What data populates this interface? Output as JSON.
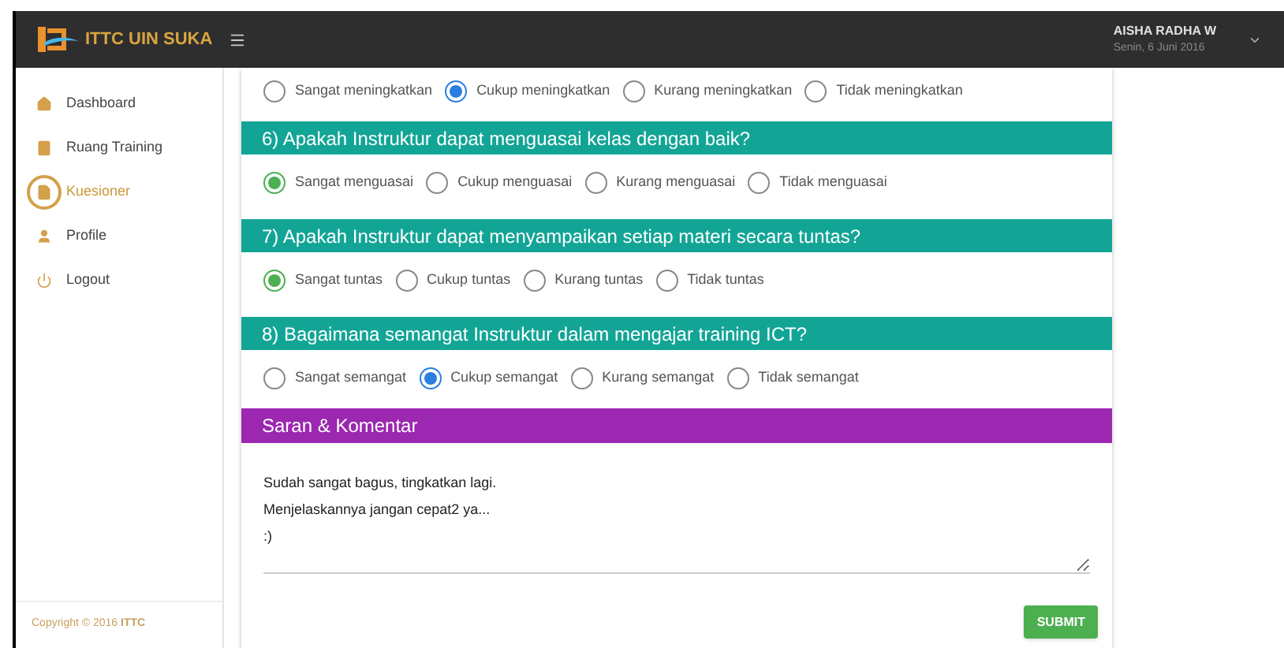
{
  "header": {
    "brand": "ITTC UIN SUKA",
    "user_name": "AISHA RADHA W",
    "date": "Senin, 6 Juni 2016"
  },
  "sidebar": {
    "items": [
      {
        "label": "Dashboard",
        "selected": false
      },
      {
        "label": "Ruang Training",
        "selected": false
      },
      {
        "label": "Kuesioner",
        "selected": true
      },
      {
        "label": "Profile",
        "selected": false
      },
      {
        "label": "Logout",
        "selected": false
      }
    ],
    "copyright": "Copyright © 2016 **ITTC**"
  },
  "questions": [
    {
      "options": [
        {
          "label": "Sangat meningkatkan",
          "selected": false
        },
        {
          "label": "Cukup meningkatkan",
          "selected": true
        },
        {
          "label": "Kurang meningkatkan",
          "selected": false
        },
        {
          "label": "Tidak meningkatkan",
          "selected": false
        }
      ]
    },
    {
      "title": "6) Apakah Instruktur dapat menguasai kelas dengan baik?",
      "options": [
        {
          "label": "Sangat menguasai",
          "selected": true
        },
        {
          "label": "Cukup menguasai",
          "selected": false
        },
        {
          "label": "Kurang menguasai",
          "selected": false
        },
        {
          "label": "Tidak menguasai",
          "selected": false
        }
      ]
    },
    {
      "title": "7) Apakah Instruktur dapat menyampaikan setiap materi secara tuntas?",
      "options": [
        {
          "label": "Sangat tuntas",
          "selected": true
        },
        {
          "label": "Cukup tuntas",
          "selected": false
        },
        {
          "label": "Kurang tuntas",
          "selected": false
        },
        {
          "label": "Tidak tuntas",
          "selected": false
        }
      ]
    },
    {
      "title": "8) Bagaimana semangat Instruktur dalam mengajar training ICT?",
      "options": [
        {
          "label": "Sangat semangat",
          "selected": false
        },
        {
          "label": "Cukup semangat",
          "selected": true
        },
        {
          "label": "Kurang semangat",
          "selected": false
        },
        {
          "label": "Tidak semangat",
          "selected": false
        }
      ]
    }
  ],
  "comment": {
    "title": "Saran & Komentar",
    "value": "Sudah sangat bagus, tingkatkan lagi.\nMenjelaskannya jangan cepat2 ya...\n:)"
  },
  "submit": "SUBMIT"
}
